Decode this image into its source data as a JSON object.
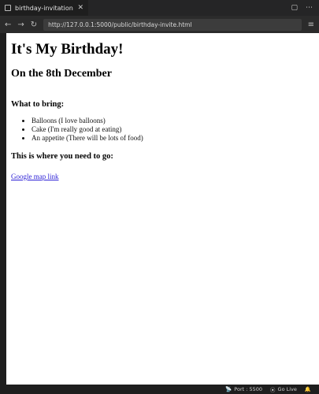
{
  "tab": {
    "title": "birthday-invitation.html",
    "close_glyph": "✕"
  },
  "tab_actions": {
    "split_glyph": "▢",
    "more_glyph": "⋯"
  },
  "address_bar": {
    "back_glyph": "←",
    "forward_glyph": "→",
    "reload_glyph": "↻",
    "url": "http://127.0.0.1:5000/public/birthday-invite.html",
    "menu_glyph": "≡"
  },
  "page": {
    "heading": "It's My Birthday!",
    "subheading": "On the 8th December",
    "bring_heading": "What to bring:",
    "bring_items": [
      "Balloons (I love balloons)",
      "Cake (I'm really good at eating)",
      "An appetite (There will be lots of food)"
    ],
    "where_heading": "This is where you need to go:",
    "map_link": "Google map link"
  },
  "status_bar": {
    "port_icon": "📡",
    "port": "Port : 5500",
    "golive_icon": "⦿",
    "golive": "Go Live",
    "bell_glyph": "🔔"
  }
}
